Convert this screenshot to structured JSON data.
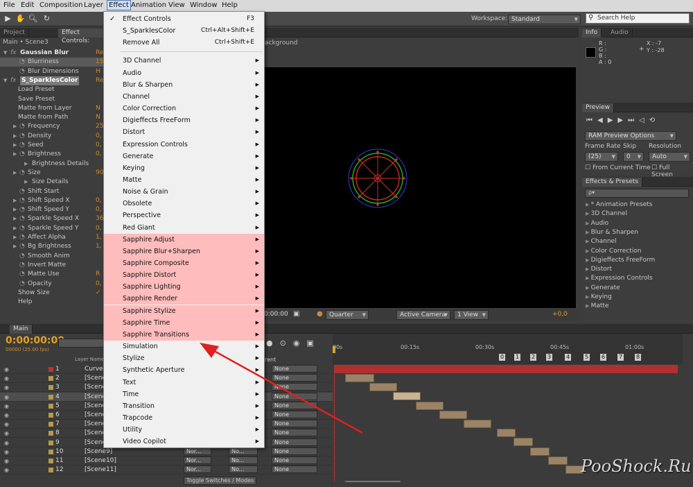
{
  "menubar": {
    "items": [
      "File",
      "Edit",
      "Composition",
      "Layer",
      "Effect",
      "Animation",
      "View",
      "Window",
      "Help"
    ]
  },
  "toolbar": {
    "workspace_label": "Workspace:",
    "workspace_value": "Standard",
    "search_placeholder": "Search Help"
  },
  "project_panel": {
    "tab_project": "Project",
    "tab_effect_controls": "Effect Controls: ",
    "breadcrumb": "Main • Scene3"
  },
  "effect_controls": {
    "rows": [
      {
        "label": "Gaussian Blur",
        "val": "Re",
        "type": "fxhdr"
      },
      {
        "label": "Blurriness",
        "val": "15",
        "type": "prop",
        "hl": true
      },
      {
        "label": "Blur Dimensions",
        "val": "H",
        "type": "prop"
      },
      {
        "label": "S_SparklesColor",
        "val": "Re",
        "type": "fxsel"
      },
      {
        "label": "Load Preset",
        "val": "",
        "type": "plain"
      },
      {
        "label": "Save Preset",
        "val": "",
        "type": "plain"
      },
      {
        "label": "Matte from Layer",
        "val": "N",
        "type": "plain"
      },
      {
        "label": "Matte from Path",
        "val": "N",
        "type": "plain"
      },
      {
        "label": "Frequency",
        "val": "25",
        "type": "tw"
      },
      {
        "label": "Density",
        "val": "0,",
        "type": "tw"
      },
      {
        "label": "Seed",
        "val": "0,",
        "type": "tw"
      },
      {
        "label": "Brightness",
        "val": "0,",
        "type": "tw"
      },
      {
        "label": "Brightness Details",
        "val": "",
        "type": "sub"
      },
      {
        "label": "Size",
        "val": "90",
        "type": "tw"
      },
      {
        "label": "Size Details",
        "val": "",
        "type": "sub"
      },
      {
        "label": "Shift Start",
        "val": "",
        "type": "sw"
      },
      {
        "label": "Shift Speed X",
        "val": "0,",
        "type": "tw"
      },
      {
        "label": "Shift Speed Y",
        "val": "0,",
        "type": "tw"
      },
      {
        "label": "Sparkle Speed X",
        "val": "36",
        "type": "tw"
      },
      {
        "label": "Sparkle Speed Y",
        "val": "0,",
        "type": "tw"
      },
      {
        "label": "Affect Alpha",
        "val": "1,",
        "type": "tw"
      },
      {
        "label": "Bg Brightness",
        "val": "1,",
        "type": "tw"
      },
      {
        "label": "Smooth Anim",
        "val": "",
        "type": "sw"
      },
      {
        "label": "Invert Matte",
        "val": "",
        "type": "sw"
      },
      {
        "label": "Matte Use",
        "val": "R",
        "type": "sw"
      },
      {
        "label": "Opacity",
        "val": "0,",
        "type": "sw"
      },
      {
        "label": "Show Size",
        "val": "✓",
        "type": "plain"
      },
      {
        "label": "Help",
        "val": "",
        "type": "plain"
      }
    ]
  },
  "composition": {
    "layer_label": "ackground",
    "timecode": "0:00:00",
    "zoom": "Quarter",
    "camera": "Active Camera",
    "view": "1 View",
    "exposure": "+0,0"
  },
  "info": {
    "tab_info": "Info",
    "tab_audio": "Audio",
    "r": "R :",
    "g": "G :",
    "b": "B :",
    "a": "A : 0",
    "x": "X : -7",
    "y": "Y : -28"
  },
  "preview": {
    "tab": "Preview",
    "ram": "RAM Preview Options",
    "frame_rate_label": "Frame Rate",
    "skip_label": "Skip",
    "resolution_label": "Resolution",
    "frame_rate": "(25)",
    "skip": "0",
    "resolution": "Auto",
    "from_current": "From Current Time",
    "full_screen": "Full Screen"
  },
  "effects_presets": {
    "tab": "Effects & Presets",
    "search": "ρ▾",
    "items": [
      "* Animation Presets",
      "3D Channel",
      "Audio",
      "Blur & Sharpen",
      "Channel",
      "Color Correction",
      "Digieffects FreeForm",
      "Distort",
      "Expression Controls",
      "Generate",
      "Keying",
      "Matte"
    ]
  },
  "effect_menu": {
    "items": [
      {
        "label": "Effect Controls",
        "shortcut": "F3",
        "checked": true
      },
      {
        "label": "S_SparklesColor",
        "shortcut": "Ctrl+Alt+Shift+E"
      },
      {
        "label": "Remove All",
        "shortcut": "Ctrl+Shift+E"
      },
      {
        "sep": true
      },
      {
        "label": "3D Channel",
        "sub": true
      },
      {
        "label": "Audio",
        "sub": true
      },
      {
        "label": "Blur & Sharpen",
        "sub": true
      },
      {
        "label": "Channel",
        "sub": true
      },
      {
        "label": "Color Correction",
        "sub": true
      },
      {
        "label": "Digieffects FreeForm",
        "sub": true
      },
      {
        "label": "Distort",
        "sub": true
      },
      {
        "label": "Expression Controls",
        "sub": true
      },
      {
        "label": "Generate",
        "sub": true
      },
      {
        "label": "Keying",
        "sub": true
      },
      {
        "label": "Matte",
        "sub": true
      },
      {
        "label": "Noise & Grain",
        "sub": true
      },
      {
        "label": "Obsolete",
        "sub": true
      },
      {
        "label": "Perspective",
        "sub": true
      },
      {
        "label": "Red Giant",
        "sub": true
      },
      {
        "label": "Sapphire Adjust",
        "sub": true,
        "saph": true
      },
      {
        "label": "Sapphire Blur+Sharpen",
        "sub": true,
        "saph": true
      },
      {
        "label": "Sapphire Composite",
        "sub": true,
        "saph": true
      },
      {
        "label": "Sapphire Distort",
        "sub": true,
        "saph": true
      },
      {
        "label": "Sapphire Lighting",
        "sub": true,
        "saph": true
      },
      {
        "label": "Sapphire Render",
        "sub": true,
        "saph": true
      },
      {
        "label": "Sapphire Stylize",
        "sub": true,
        "saph": true
      },
      {
        "label": "Sapphire Time",
        "sub": true,
        "saph": true
      },
      {
        "label": "Sapphire Transitions",
        "sub": true,
        "saph": true
      },
      {
        "label": "Simulation",
        "sub": true
      },
      {
        "label": "Stylize",
        "sub": true
      },
      {
        "label": "Synthetic Aperture",
        "sub": true
      },
      {
        "label": "Text",
        "sub": true
      },
      {
        "label": "Time",
        "sub": true
      },
      {
        "label": "Transition",
        "sub": true
      },
      {
        "label": "Trapcode",
        "sub": true
      },
      {
        "label": "Utility",
        "sub": true
      },
      {
        "label": "Video Copilot",
        "sub": true
      }
    ]
  },
  "timeline": {
    "tab": "Main",
    "timecode": "0:00:00:00",
    "fps": "00000 (25.00 fps)",
    "col_layer_name": "Layer Name",
    "col_parent": "rent",
    "ruler": [
      "00s",
      "00:15s",
      "00:30s",
      "00:45s",
      "01:00s"
    ],
    "markers": [
      "0",
      "1",
      "2",
      "3",
      "4",
      "5",
      "6",
      "7",
      "8"
    ],
    "layers": [
      {
        "num": "1",
        "name": "Curves",
        "parent": "None",
        "mode": ""
      },
      {
        "num": "2",
        "name": "[Scene",
        "parent": "None",
        "mode": ""
      },
      {
        "num": "3",
        "name": "[Scene",
        "parent": "None",
        "mode": ""
      },
      {
        "num": "4",
        "name": "[Scene",
        "parent": "None",
        "mode": ""
      },
      {
        "num": "5",
        "name": "[Scene",
        "parent": "None",
        "mode": ""
      },
      {
        "num": "6",
        "name": "[Scene",
        "parent": "None",
        "mode": ""
      },
      {
        "num": "7",
        "name": "[Scene",
        "parent": "None",
        "mode": ""
      },
      {
        "num": "8",
        "name": "[Scene",
        "parent": "None",
        "mode": ""
      },
      {
        "num": "9",
        "name": "[Scene",
        "parent": "None",
        "mode": ""
      },
      {
        "num": "10",
        "name": "[Scene9]",
        "parent": "None",
        "mode": "Nor..."
      },
      {
        "num": "11",
        "name": "[Scene10]",
        "parent": "None",
        "mode": "Nor..."
      },
      {
        "num": "12",
        "name": "[Scene11]",
        "parent": "None",
        "mode": "Nor..."
      }
    ],
    "toggle": "Toggle Switches / Modes",
    "mode_no": "No..."
  },
  "watermark": "PooShock.Ru"
}
